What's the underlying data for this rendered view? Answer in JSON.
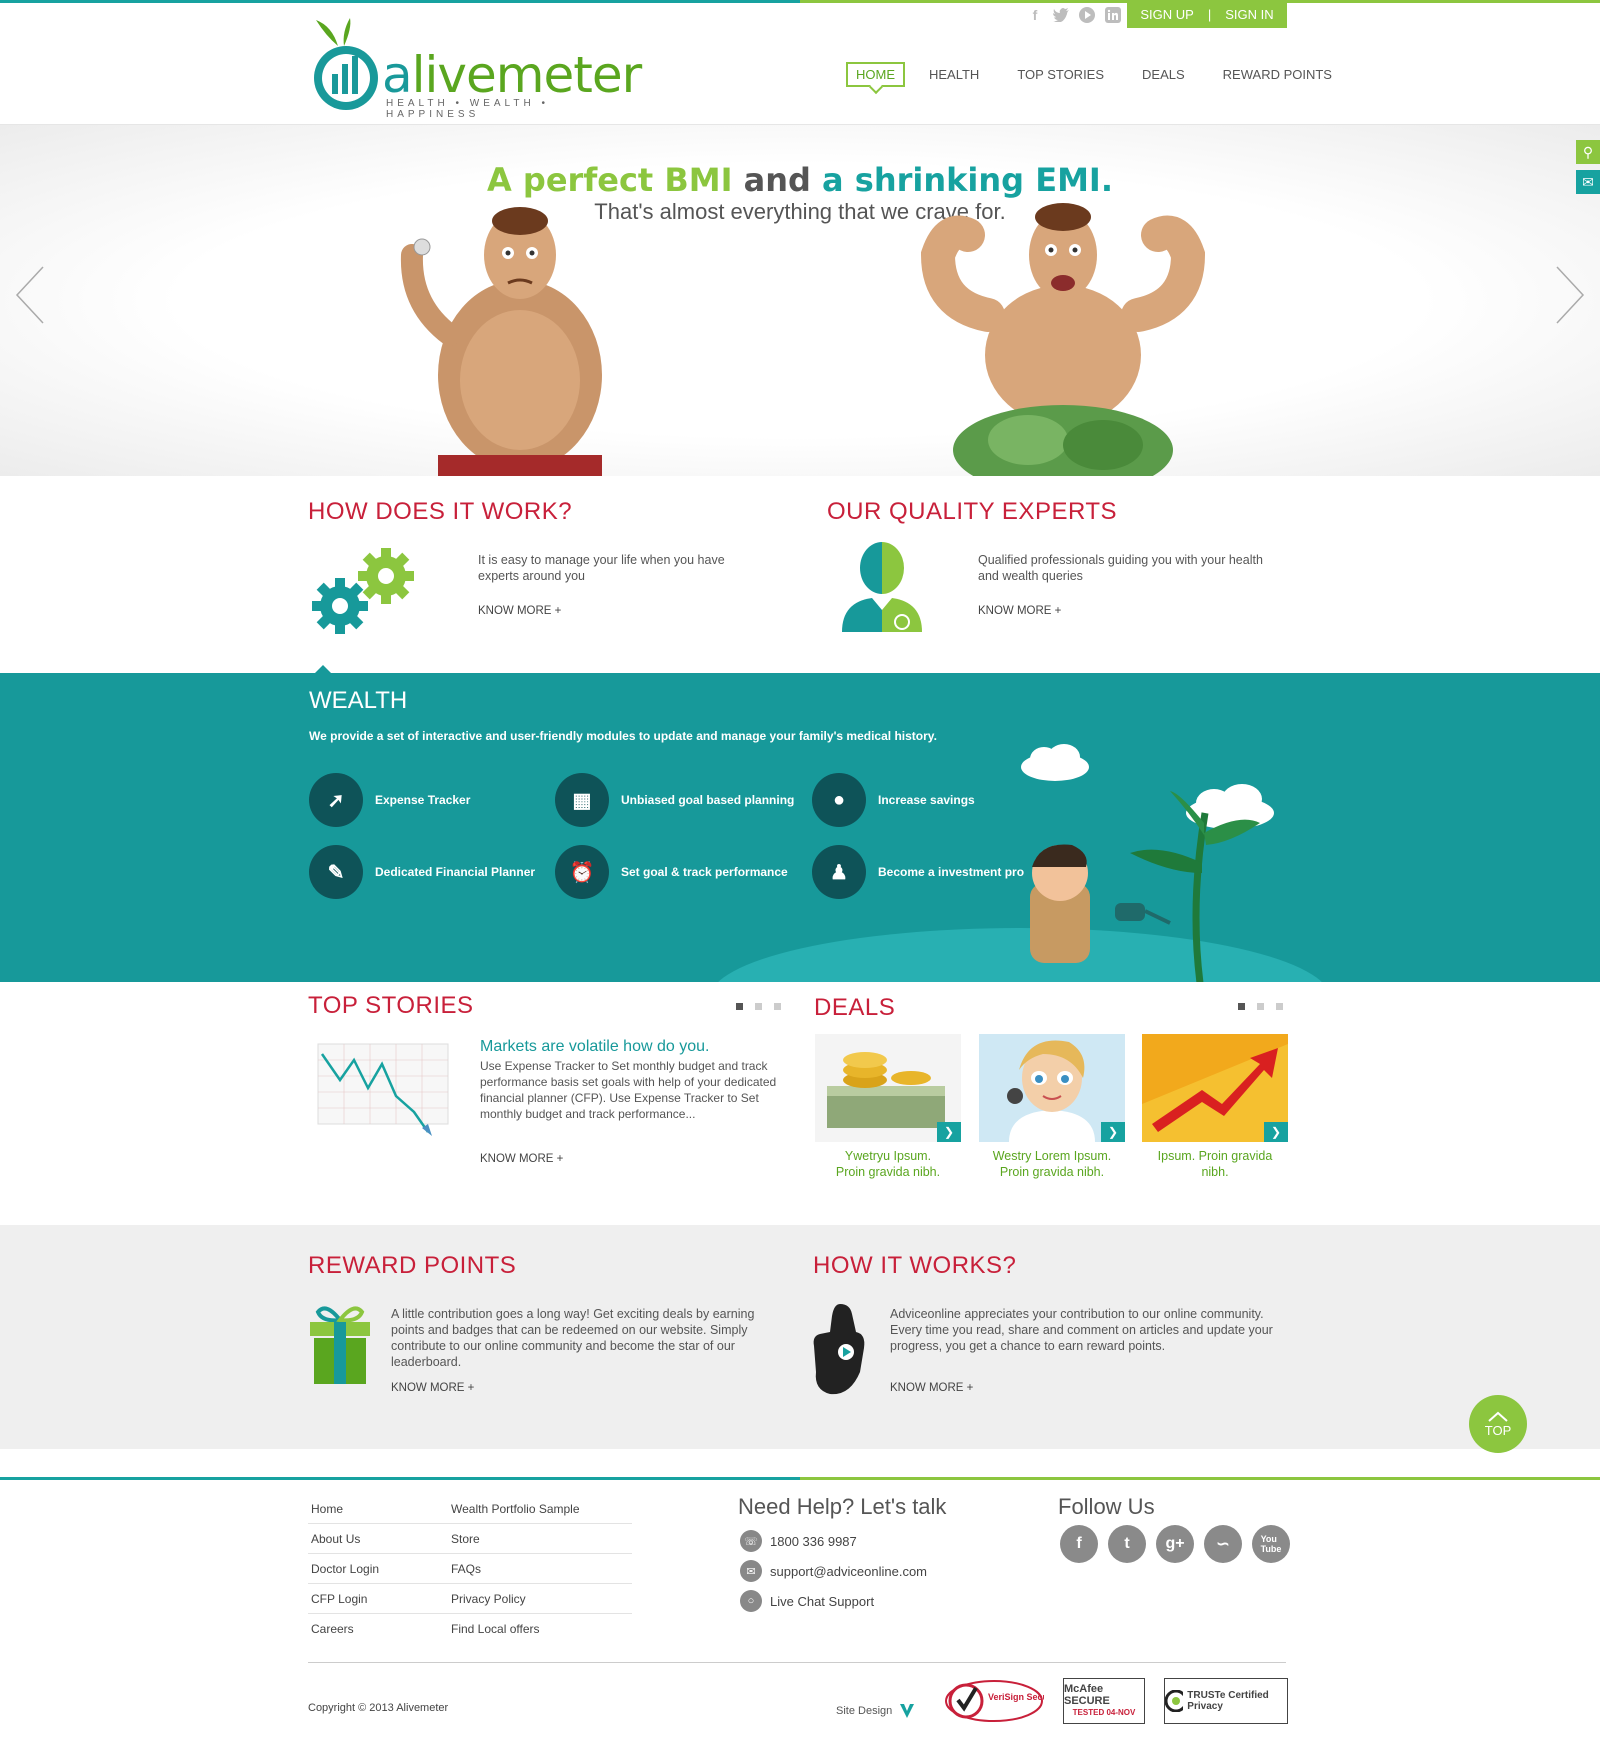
{
  "brand": {
    "name_prefix": "a",
    "name_rest": "livemeter",
    "tagline": "HEALTH • WEALTH • HAPPINESS"
  },
  "auth": {
    "sign_up": "SIGN UP",
    "sep": "|",
    "sign_in": "SIGN IN"
  },
  "nav": [
    "HOME",
    "HEALTH",
    "TOP STORIES",
    "DEALS",
    "REWARD POINTS"
  ],
  "hero": {
    "title_a": "A perfect BMI",
    "title_b": "and",
    "title_c": "a shrinking EMI.",
    "subtitle": "That's almost everything that we crave for."
  },
  "how_works": {
    "title": "HOW DOES IT WORK?",
    "text": "It is easy to manage your life when you have experts around you",
    "more": "KNOW MORE +"
  },
  "experts": {
    "title": "OUR QUALITY EXPERTS",
    "text": "Qualified professionals guiding you with your health and wealth queries",
    "more": "KNOW MORE +"
  },
  "wealth": {
    "title": "WEALTH",
    "desc": "We provide a set of interactive and user-friendly modules to update and manage your family's medical history.",
    "features": [
      "Expense Tracker",
      "Unbiased goal based planning",
      "Increase savings",
      "Dedicated Financial Planner",
      "Set goal & track performance",
      "Become a investment pro"
    ]
  },
  "top_stories": {
    "title": "TOP STORIES",
    "headline": "Markets are volatile how do you.",
    "body": "Use Expense Tracker to Set monthly budget and track performance basis set goals with help of your dedicated financial planner (CFP). Use Expense Tracker to Set monthly budget and track performance...",
    "more": "KNOW MORE +"
  },
  "deals": {
    "title": "DEALS",
    "items": [
      {
        "line1": "Ywetryu Ipsum.",
        "line2": "Proin gravida nibh."
      },
      {
        "line1": "Westry Lorem Ipsum.",
        "line2": "Proin gravida nibh."
      },
      {
        "line1": "Ipsum. Proin gravida",
        "line2": "nibh."
      }
    ]
  },
  "reward": {
    "title": "REWARD POINTS",
    "text": "A little contribution goes a long way! Get exciting deals by earning points and badges that can be redeemed on our website. Simply contribute to our online community and become the star of our leaderboard.",
    "more": "KNOW MORE +"
  },
  "how_it_works": {
    "title": "HOW IT WORKS?",
    "text": "Adviceonline appreciates your contribution to our online community. Every time you read, share and comment on articles and update your progress, you get a chance to earn reward points.",
    "more": "KNOW MORE +"
  },
  "top_button": "TOP",
  "footer": {
    "links_left": [
      "Home",
      "About Us",
      "Doctor Login",
      "CFP Login",
      "Careers"
    ],
    "links_right": [
      "Wealth Portfolio Sample",
      "Store",
      "FAQs",
      "Privacy Policy",
      "Find Local offers"
    ],
    "help_title": "Need Help? Let's talk",
    "phone": "1800 336 9987",
    "email": "support@adviceonline.com",
    "chat": "Live Chat Support",
    "follow_title": "Follow Us",
    "copyright": "Copyright © 2013 Alivemeter",
    "site_design": "Site Design",
    "badges": [
      "VeriSign Secured",
      "McAfee SECURE",
      "TRUSTe Certified Privacy"
    ],
    "mcafee_sub": "TESTED 04-NOV"
  },
  "colors": {
    "teal": "#17a2a0",
    "green": "#8cc63f",
    "red": "#c8203a"
  }
}
